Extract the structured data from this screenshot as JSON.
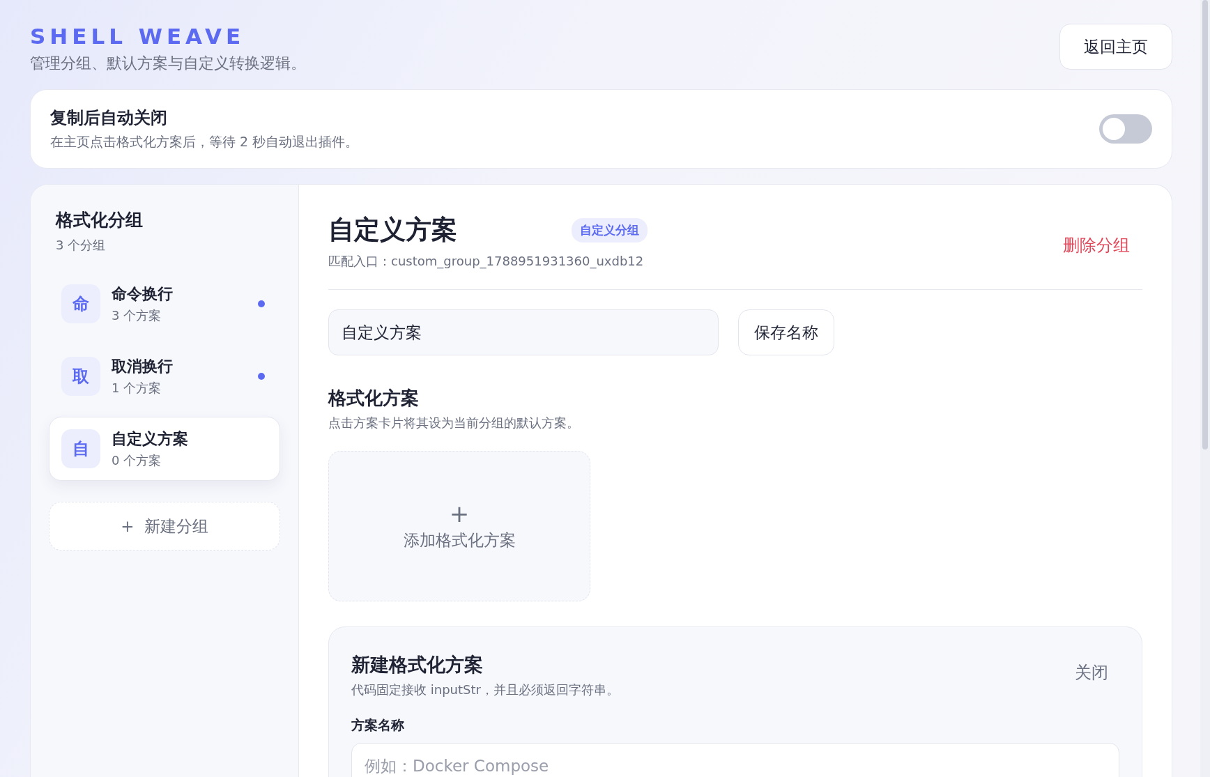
{
  "header": {
    "brand": "SHELL WEAVE",
    "subtitle": "管理分组、默认方案与自定义转换逻辑。",
    "back_button": "返回主页"
  },
  "auto_close": {
    "title": "复制后自动关闭",
    "description": "在主页点击格式化方案后，等待 2 秒自动退出插件。",
    "on": false
  },
  "sidebar": {
    "title": "格式化分组",
    "count": "3 个分组",
    "items": [
      {
        "icon_char": "命",
        "name": "命令换行",
        "count": "3 个方案",
        "selected": false,
        "marked": true
      },
      {
        "icon_char": "取",
        "name": "取消换行",
        "count": "1 个方案",
        "selected": false,
        "marked": true
      },
      {
        "icon_char": "自",
        "name": "自定义方案",
        "count": "0 个方案",
        "selected": true,
        "marked": false
      }
    ],
    "add_button": {
      "plus": "+",
      "label": "新建分组"
    }
  },
  "group": {
    "title": "自定义方案",
    "badge": "自定义分组",
    "entry": "匹配入口：custom_group_1788951931360_uxdb12",
    "delete_button": "删除分组",
    "name_value": "自定义方案",
    "save_button": "保存名称"
  },
  "schemes": {
    "title": "格式化方案",
    "hint": "点击方案卡片将其设为当前分组的默认方案。",
    "add_card": {
      "plus": "+",
      "label": "添加格式化方案"
    }
  },
  "new_scheme": {
    "title": "新建格式化方案",
    "description": "代码固定接收 inputStr，并且必须返回字符串。",
    "close_button": "关闭",
    "name_label": "方案名称",
    "name_placeholder": "例如：Docker Compose"
  }
}
